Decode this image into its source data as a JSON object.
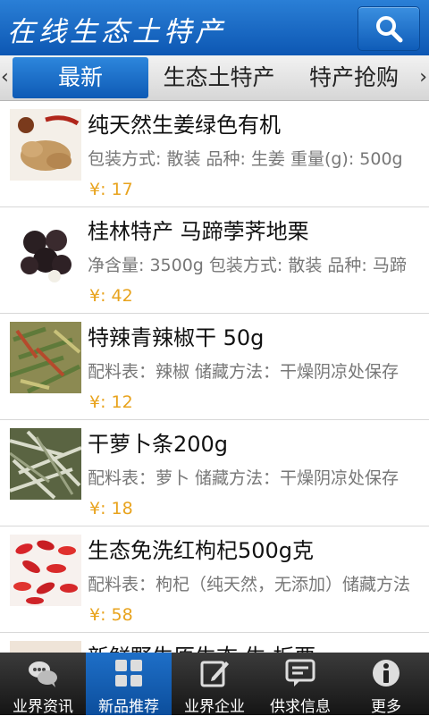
{
  "header": {
    "title": "在线生态土特产"
  },
  "tabs": {
    "left_arrow": "‹",
    "right_arrow": "›",
    "items": [
      "最新",
      "生态土特产",
      "特产抢购"
    ]
  },
  "products": [
    {
      "name": "纯天然生姜绿色有机",
      "spec": "包装方式: 散装 品种: 生姜 重量(g): 500g",
      "price": "¥: 17"
    },
    {
      "name": "桂林特产 马蹄荸荠地栗",
      "spec": "净含量: 3500g 包装方式: 散装 品种: 马蹄",
      "price": "¥: 42"
    },
    {
      "name": " 特辣青辣椒干 50g",
      "spec": "配料表：辣椒 储藏方法：干燥阴凉处保存",
      "price": "¥: 12"
    },
    {
      "name": "干萝卜条200g",
      "spec": "配料表：萝卜 储藏方法：干燥阴凉处保存",
      "price": "¥: 18"
    },
    {
      "name": "生态免洗红枸杞500g克",
      "spec": "配料表：枸杞（纯天然，无添加）储藏方法",
      "price": "¥: 58"
    },
    {
      "name": "新鲜野生原生态 生 板栗",
      "spec": "",
      "price": ""
    }
  ],
  "bottom_nav": [
    {
      "label": "业界资讯",
      "icon": "chat-bubbles-icon"
    },
    {
      "label": "新品推荐",
      "icon": "grid-icon"
    },
    {
      "label": "业界企业",
      "icon": "edit-icon"
    },
    {
      "label": "供求信息",
      "icon": "message-icon"
    },
    {
      "label": "更多",
      "icon": "info-icon"
    }
  ],
  "colors": {
    "primary_blue": "#0d57b3",
    "price_orange": "#e8a31d",
    "bottom_bar": "#1a1a1a"
  }
}
